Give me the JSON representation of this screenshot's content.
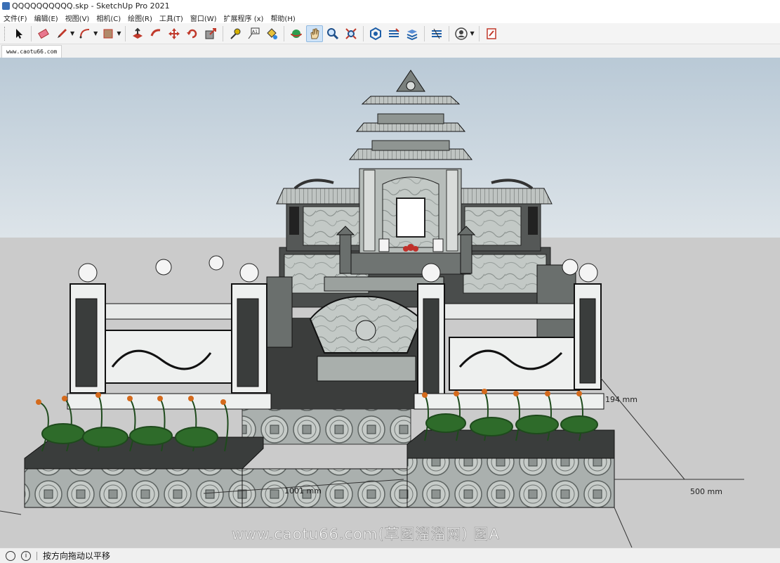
{
  "window": {
    "title": "QQQQQQQQQQ.skp - SketchUp Pro 2021"
  },
  "menu": [
    "文件(F)",
    "编辑(E)",
    "视图(V)",
    "相机(C)",
    "绘图(R)",
    "工具(T)",
    "窗口(W)",
    "扩展程序 (x)",
    "帮助(H)"
  ],
  "toolbar_icons": [
    "select-tool",
    "eraser-tool",
    "pencil-line-tool",
    "arc-tool",
    "rectangle-tool",
    "push-pull-tool",
    "follow-me-tool",
    "move-tool",
    "rotate-tool",
    "scale-tool",
    "tape-measure-tool",
    "text-tool",
    "paint-bucket-tool",
    "orbit-tool",
    "pan-tool",
    "zoom-tool",
    "zoom-extents-tool",
    "warehouse-tool",
    "extension-warehouse-tool",
    "layout-tool",
    "sandbox-tool",
    "account-tool",
    "report-tool"
  ],
  "scene_tab": "www.caotu66.com",
  "dimensions": {
    "d1": "194 mm",
    "d2": "1001 mm",
    "d3": "500 mm"
  },
  "watermark": "www.caotu66.com(草图溜溜网) 图A",
  "status": {
    "hint": "按方向拖动以平移"
  },
  "colors": {
    "sky": "#c7d3dc",
    "ground": "#cbcbcb",
    "stone": "#c8ccc9",
    "stone_dark": "#3c3c3c",
    "plants": "#2e6b2a",
    "flower": "#d46a1c"
  }
}
